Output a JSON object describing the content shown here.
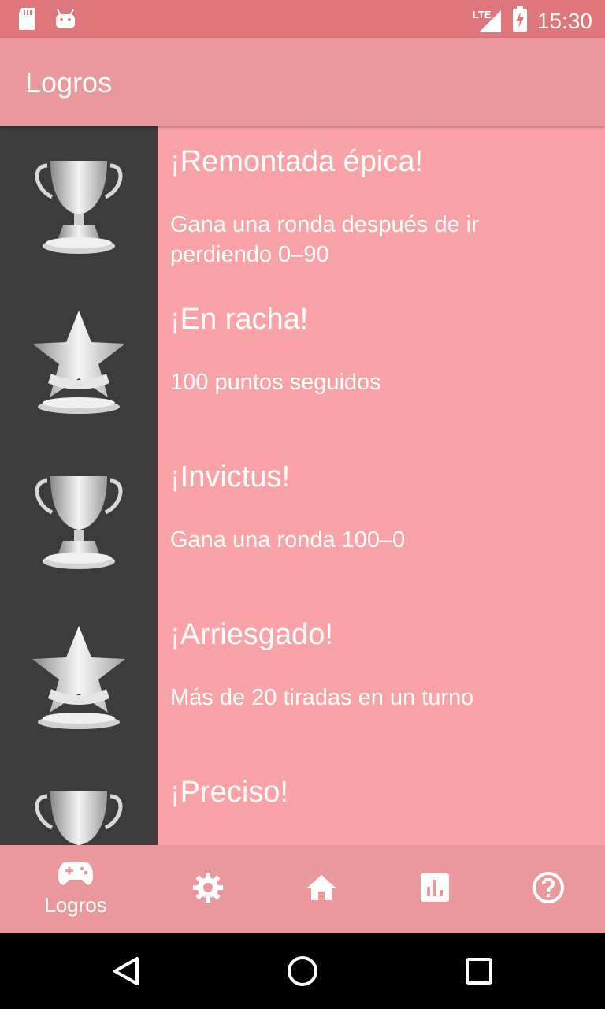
{
  "status_bar": {
    "network": "LTE",
    "time": "15:30"
  },
  "app_bar": {
    "title": "Logros"
  },
  "achievements": [
    {
      "icon": "trophy-cup-icon",
      "title": "¡Remontada épica!",
      "description": "Gana una ronda después de ir perdiendo 0–90"
    },
    {
      "icon": "star-trophy-icon",
      "title": "¡En racha!",
      "description": "100 puntos seguidos"
    },
    {
      "icon": "trophy-cup-icon",
      "title": "¡Invictus!",
      "description": "Gana una ronda 100–0"
    },
    {
      "icon": "star-trophy-icon",
      "title": "¡Arriesgado!",
      "description": "Más de 20 tiradas en un turno"
    },
    {
      "icon": "trophy-cup-icon",
      "title": "¡Preciso!",
      "description": ""
    }
  ],
  "bottom_nav": {
    "items": [
      {
        "icon": "gamepad-icon",
        "label": "Logros",
        "selected": true
      },
      {
        "icon": "gear-icon",
        "label": ""
      },
      {
        "icon": "home-icon",
        "label": ""
      },
      {
        "icon": "bar-chart-icon",
        "label": ""
      },
      {
        "icon": "help-icon",
        "label": ""
      }
    ]
  },
  "colors": {
    "status_bar": "#df767b",
    "app_bar": "#ea989b",
    "content_bg": "#f9a3a8",
    "thumb_bg": "#3c3c3c",
    "text": "#ffffff"
  }
}
